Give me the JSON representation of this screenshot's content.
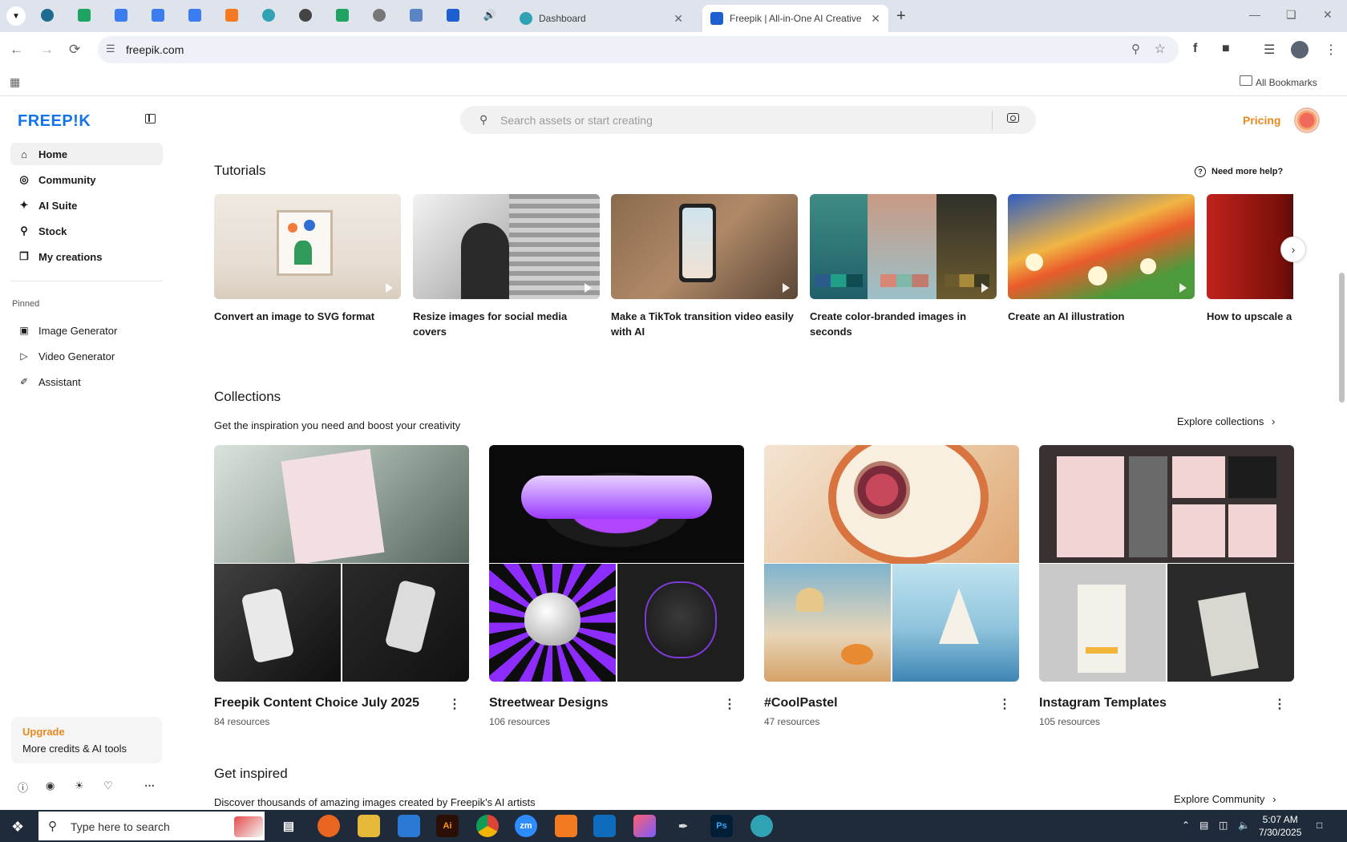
{
  "browser": {
    "tabs": [
      {
        "label": "Dashboard",
        "active": false
      },
      {
        "label": "Freepik | All-in-One AI Creative",
        "active": true
      }
    ],
    "url": "freepik.com",
    "all_bookmarks": "All Bookmarks"
  },
  "sidebar": {
    "logo": "FREEP!K",
    "nav": [
      {
        "label": "Home",
        "icon": "home-icon",
        "active": true
      },
      {
        "label": "Community",
        "icon": "globe-icon"
      },
      {
        "label": "AI Suite",
        "icon": "sparkle-icon"
      },
      {
        "label": "Stock",
        "icon": "search-icon"
      },
      {
        "label": "My creations",
        "icon": "stack-icon"
      }
    ],
    "pinned_label": "Pinned",
    "pinned": [
      {
        "label": "Image Generator",
        "icon": "image-icon"
      },
      {
        "label": "Video Generator",
        "icon": "video-icon"
      },
      {
        "label": "Assistant",
        "icon": "assistant-icon"
      }
    ],
    "upgrade": {
      "title": "Upgrade",
      "subtitle": "More credits & AI tools"
    }
  },
  "header": {
    "search_placeholder": "Search assets or start creating",
    "pricing": "Pricing"
  },
  "tutorials": {
    "title": "Tutorials",
    "help": "Need more help?",
    "items": [
      {
        "label": "Convert an image to SVG format"
      },
      {
        "label": "Resize images for social media covers"
      },
      {
        "label": "Make a TikTok transition video easily with AI"
      },
      {
        "label": "Create color-branded images in seconds"
      },
      {
        "label": "Create an AI illustration"
      },
      {
        "label": "How to upscale a v"
      }
    ]
  },
  "collections": {
    "title": "Collections",
    "subtitle": "Get the inspiration you need and boost your creativity",
    "explore": "Explore collections",
    "items": [
      {
        "title": "Freepik Content Choice July 2025",
        "count": "84 resources"
      },
      {
        "title": "Streetwear Designs",
        "count": "106 resources"
      },
      {
        "title": "#CoolPastel",
        "count": "47 resources"
      },
      {
        "title": "Instagram Templates",
        "count": "105 resources"
      }
    ]
  },
  "inspired": {
    "title": "Get inspired",
    "subtitle": "Discover thousands of amazing images created by Freepik's AI artists",
    "explore": "Explore Community"
  },
  "taskbar": {
    "search_text": "Type here to search",
    "time": "5:07 AM",
    "date": "7/30/2025"
  },
  "colors": {
    "brand": "#1273eb",
    "accent": "#e58a1f"
  }
}
